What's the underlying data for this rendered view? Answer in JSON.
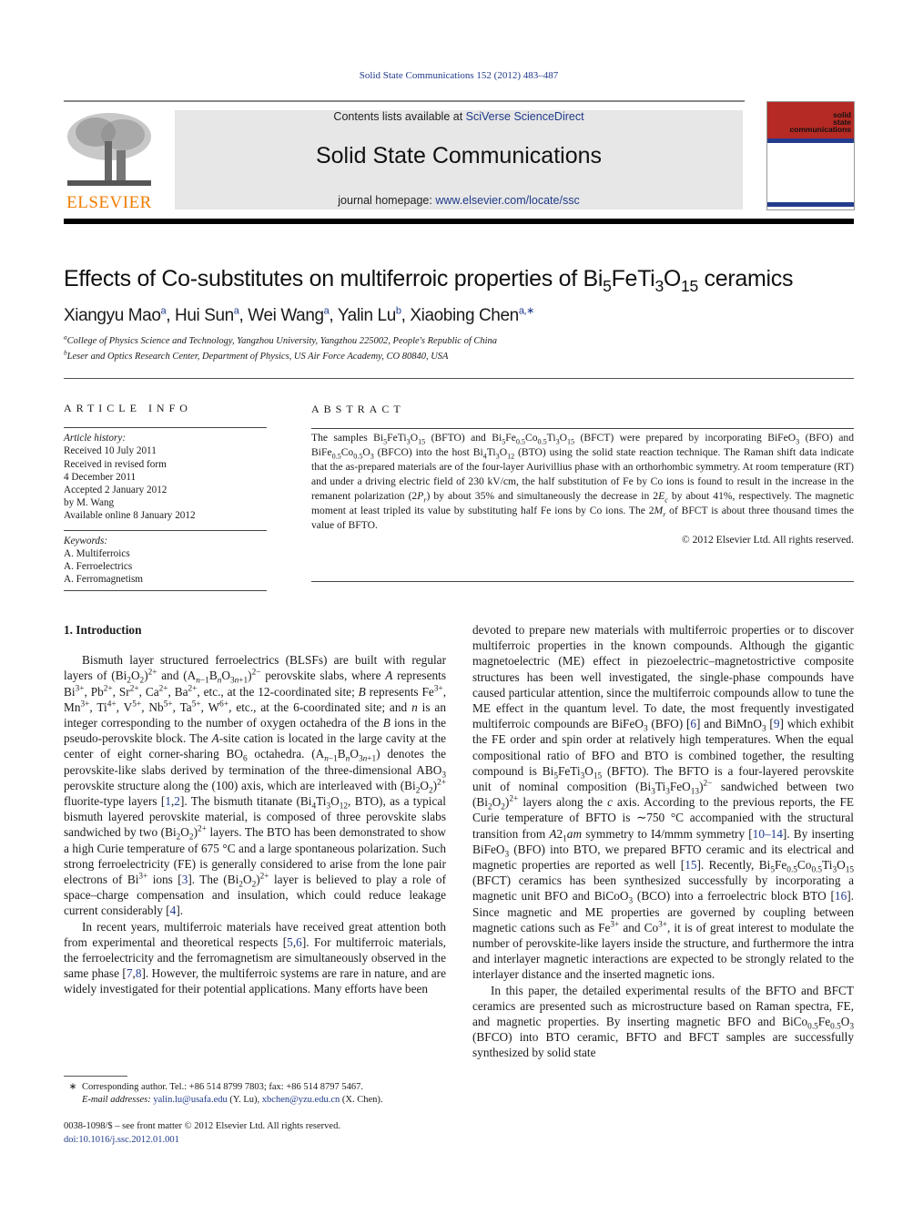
{
  "header": {
    "journal_ref": "Solid State Communications 152 (2012) 483–487",
    "contents_prefix": "Contents lists available at ",
    "contents_link": "SciVerse ScienceDirect",
    "journal_title": "Solid State Communications",
    "homepage_prefix": "journal homepage: ",
    "homepage_link": "www.elsevier.com/locate/ssc",
    "publisher_logo_text": "ELSEVIER",
    "cover": {
      "line1": "solid",
      "line2": "state",
      "line3": "communications"
    },
    "colors": {
      "link": "#1f3a8a",
      "elsevier_orange": "#f07d00",
      "cover_red": "#b52a24",
      "banner_gray": "#e7e7e7"
    }
  },
  "article": {
    "title_pre": "Effects of Co-substitutes on multiferroic properties of Bi",
    "title_s1": "5",
    "title_mid1": "FeTi",
    "title_s2": "3",
    "title_mid2": "O",
    "title_s3": "15",
    "title_post": " ceramics",
    "authors": [
      {
        "name": "Xiangyu Mao",
        "aff": "a"
      },
      {
        "name": "Hui Sun",
        "aff": "a"
      },
      {
        "name": "Wei Wang",
        "aff": "a"
      },
      {
        "name": "Yalin Lu",
        "aff": "b"
      },
      {
        "name": "Xiaobing Chen",
        "aff": "a,∗"
      }
    ],
    "affiliations": [
      {
        "mark": "a",
        "text": "College of Physics Science and Technology, Yangzhou University, Yangzhou 225002, People's Republic of China"
      },
      {
        "mark": "b",
        "text": "Leser and Optics Research Center, Department of Physics, US Air Force Academy, CO 80840, USA"
      }
    ]
  },
  "article_info": {
    "heading": "ARTICLE INFO",
    "history_label": "Article history:",
    "history": [
      "Received 10 July 2011",
      "Received in revised form",
      "4 December 2011",
      "Accepted 2 January 2012",
      "by M. Wang",
      "Available online 8 January 2012"
    ],
    "keywords_label": "Keywords:",
    "keywords": [
      "A. Multiferroics",
      "A. Ferroelectrics",
      "A. Ferromagnetism"
    ]
  },
  "abstract": {
    "heading": "ABSTRACT",
    "copyright": "© 2012 Elsevier Ltd. All rights reserved."
  },
  "intro": {
    "heading": "1. Introduction"
  },
  "footnote": {
    "star": "∗",
    "corresponding": "Corresponding author. Tel.: +86 514 8799 7803; fax: +86 514 8797 5467.",
    "email_label": "E-mail addresses:",
    "email1": "yalin.lu@usafa.edu",
    "email1_who": " (Y. Lu), ",
    "email2": "xbchen@yzu.edu.cn",
    "email2_who": " (X. Chen)."
  },
  "front_matter": {
    "issn_line": "0038-1098/$ – see front matter © 2012 Elsevier Ltd. All rights reserved.",
    "doi": "doi:10.1016/j.ssc.2012.01.001"
  }
}
